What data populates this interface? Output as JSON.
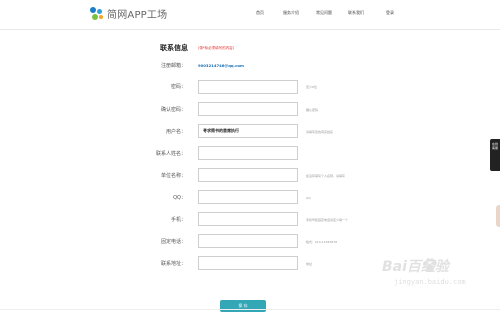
{
  "header": {
    "logo_text": "简网APP工场",
    "nav": [
      {
        "label": "首页"
      },
      {
        "label": "服务介绍"
      },
      {
        "label": "常见问题"
      },
      {
        "label": "联系我们"
      },
      {
        "label": "登录"
      }
    ]
  },
  "form": {
    "title": "联系信息",
    "note": "(带*标必须填写的内容)",
    "email_label": "注册邮箱：",
    "email_value": "9003214746@qq.com",
    "rows": [
      {
        "label": "密码：",
        "value": "",
        "hint": "至少6位"
      },
      {
        "label": "确认密码：",
        "value": "",
        "hint": "确认密码"
      },
      {
        "label": "用户名：",
        "value": "寻求简书的首席执行",
        "hint": "请填写您的真实姓名"
      },
      {
        "label": "联系人姓名：",
        "value": "",
        "hint": ""
      },
      {
        "label": "单位名称：",
        "value": "",
        "hint": "如没有填写个人名称，请填写"
      },
      {
        "label": "QQ：",
        "value": "",
        "hint": "QQ"
      },
      {
        "label": "手机：",
        "value": "",
        "hint": "手机号和固定电话请至少填一个"
      },
      {
        "label": "固定电话：",
        "value": "",
        "hint": "格式：010-12345678"
      },
      {
        "label": "联系地址：",
        "value": "",
        "hint": "地址"
      }
    ],
    "save_label": "保 存"
  },
  "side_tab": {
    "label": "在线客服"
  },
  "watermark": {
    "main": "Bai百经验",
    "url": "jingyan.baidu.com"
  },
  "colors": {
    "accent": "#34a7b7",
    "note": "#e02a2a",
    "email": "#1a6fb5"
  }
}
